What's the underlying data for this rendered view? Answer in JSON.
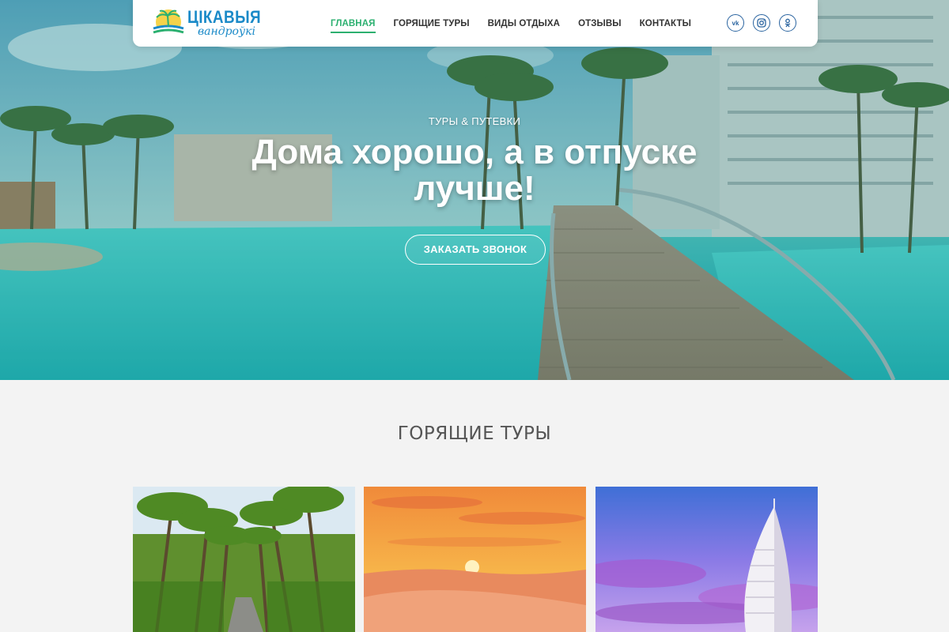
{
  "header": {
    "logo": {
      "line1": "ЦІКАВЫЯ",
      "line2": "вандроўкі"
    },
    "nav": [
      {
        "label": "ГЛАВНАЯ",
        "active": true
      },
      {
        "label": "ГОРЯЩИЕ ТУРЫ",
        "active": false
      },
      {
        "label": "ВИДЫ ОТДЫХА",
        "active": false
      },
      {
        "label": "ОТЗЫВЫ",
        "active": false
      },
      {
        "label": "КОНТАКТЫ",
        "active": false
      }
    ],
    "socials": [
      {
        "icon": "vk-icon",
        "glyph": "vk"
      },
      {
        "icon": "instagram-icon",
        "glyph": ""
      },
      {
        "icon": "odnoklassniki-icon",
        "glyph": ""
      }
    ]
  },
  "hero": {
    "subtitle": "ТУРЫ & ПУТЕВКИ",
    "title": "Дома хорошо, а в отпуске лучше!",
    "cta_label": "ЗАКАЗАТЬ ЗВОНОК"
  },
  "section": {
    "title": "ГОРЯЩИЕ ТУРЫ",
    "cards": [
      {
        "image": "palm-road-image"
      },
      {
        "image": "desert-sunset-image"
      },
      {
        "image": "burj-al-arab-image"
      }
    ]
  },
  "colors": {
    "accent": "#2cb070",
    "brand_blue": "#1b8ac8",
    "social_blue": "#2a64a0",
    "page_bg": "#f3f3f3"
  }
}
